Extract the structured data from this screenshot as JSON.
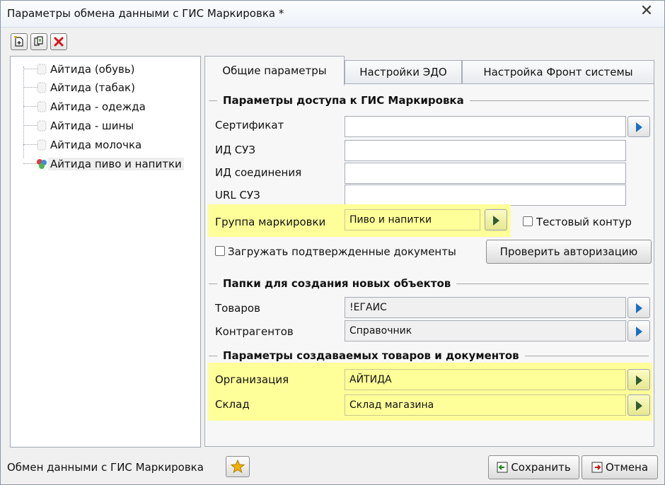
{
  "window": {
    "title": "Параметры обмена данными с ГИС Маркировка *",
    "close_glyph": "✕"
  },
  "toolbar": {
    "buttons": [
      {
        "name": "add",
        "icon": "new-document-icon"
      },
      {
        "name": "copy",
        "icon": "copy-document-icon"
      },
      {
        "name": "delete",
        "icon": "red-cross-icon"
      }
    ]
  },
  "tree": {
    "items": [
      {
        "label": "Айтида (обувь)",
        "icon": "blank-page-icon"
      },
      {
        "label": "Айтида (табак)",
        "icon": "blank-page-icon"
      },
      {
        "label": "Айтида - одежда",
        "icon": "blank-page-icon"
      },
      {
        "label": "Айтида - шины",
        "icon": "blank-page-icon"
      },
      {
        "label": "Айтида молочка",
        "icon": "blank-page-icon"
      },
      {
        "label": "Айтида пиво и напитки",
        "icon": "colored-circles-icon",
        "selected": true
      }
    ]
  },
  "tabs": [
    {
      "label": "Общие параметры",
      "active": true
    },
    {
      "label": "Настройки ЭДО",
      "active": false
    },
    {
      "label": "Настройка Фронт системы",
      "active": false
    }
  ],
  "access": {
    "section_title": "Параметры доступа к ГИС Маркировка",
    "certificate_label": "Сертификат",
    "certificate_value": "",
    "suz_id_label": "ИД СУЗ",
    "suz_id_value": "",
    "connection_id_label": "ИД соединения",
    "connection_id_value": "",
    "suz_url_label": "URL СУЗ",
    "suz_url_value": "",
    "group_label": "Группа маркировки",
    "group_value": "Пиво и напитки",
    "test_contour_label": "Тестовый контур",
    "test_contour_checked": false,
    "load_confirmed_label": "Загружать подтвержденные документы",
    "load_confirmed_checked": false,
    "check_auth_label": "Проверить авторизацию"
  },
  "folders": {
    "section_title": "Папки для создания новых объектов",
    "goods_label": "Товаров",
    "goods_value": "!ЕГАИС",
    "contractors_label": "Контрагентов",
    "contractors_value": "Справочник"
  },
  "params": {
    "section_title": "Параметры создаваемых товаров и документов",
    "organization_label": "Организация",
    "organization_value": "АЙТИДА",
    "warehouse_label": "Склад",
    "warehouse_value": "Склад магазина"
  },
  "footer": {
    "label": "Обмен данными с ГИС Маркировка",
    "favorite_icon": "star-icon",
    "save_label": "Сохранить",
    "cancel_label": "Отмена"
  },
  "colors": {
    "highlight": "#ffff9a",
    "accent_blue": "#1c6fbf"
  }
}
